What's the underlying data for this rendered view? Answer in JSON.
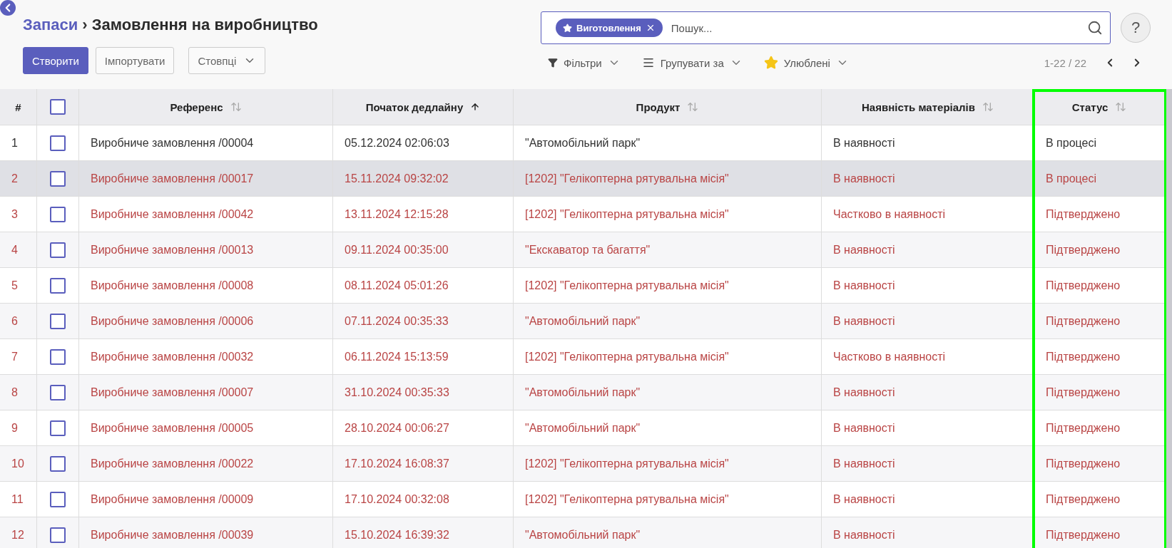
{
  "breadcrumb": {
    "parent": "Запаси",
    "separator": "›",
    "current": "Замовлення на виробництво"
  },
  "actions": [
    {
      "label": "Створити",
      "kind": "primary"
    },
    {
      "label": "Імпортувати",
      "kind": "secondary"
    },
    {
      "label": "Стовпці",
      "kind": "dropdown"
    }
  ],
  "search": {
    "facet": "Виготовлення",
    "placeholder": "Пошук..."
  },
  "help": "?",
  "filters": [
    {
      "label": "Фільтри",
      "kind": "filter"
    },
    {
      "label": "Групувати за",
      "kind": "group"
    },
    {
      "label": "Улюблені",
      "kind": "favorite"
    }
  ],
  "pager": "1-22 / 22",
  "table": {
    "number_header": "#",
    "select_all": {
      "checked": false
    },
    "columns": [
      {
        "label": "Референс",
        "sorted": false,
        "highlighted": false
      },
      {
        "label": "Початок дедлайну",
        "sorted": true,
        "highlighted": false
      },
      {
        "label": "Продукт",
        "sorted": false,
        "highlighted": false
      },
      {
        "label": "Наявність матеріалів",
        "sorted": false,
        "highlighted": false
      },
      {
        "label": "Статус",
        "sorted": false,
        "highlighted": true
      }
    ],
    "rows": [
      {
        "num": "1",
        "checked": false,
        "selected": false,
        "late": false,
        "cells": [
          "Виробниче замовлення /00004",
          "05.12.2024 02:06:03",
          "\"Автомобільний парк\"",
          "В наявності",
          "В процесі"
        ]
      },
      {
        "num": "2",
        "checked": false,
        "selected": true,
        "late": true,
        "cells": [
          "Виробниче замовлення /00017",
          "15.11.2024 09:32:02",
          "[1202] \"Гелікоптерна рятувальна місія\"",
          "В наявності",
          "В процесі"
        ]
      },
      {
        "num": "3",
        "checked": false,
        "selected": false,
        "late": true,
        "cells": [
          "Виробниче замовлення /00042",
          "13.11.2024 12:15:28",
          "[1202] \"Гелікоптерна рятувальна місія\"",
          "Частково в наявності",
          "Підтверджено"
        ]
      },
      {
        "num": "4",
        "checked": false,
        "selected": false,
        "late": true,
        "cells": [
          "Виробниче замовлення /00013",
          "09.11.2024 00:35:00",
          "\"Екскаватор та багаття\"",
          "В наявності",
          "Підтверджено"
        ]
      },
      {
        "num": "5",
        "checked": false,
        "selected": false,
        "late": true,
        "cells": [
          "Виробниче замовлення /00008",
          "08.11.2024 05:01:26",
          "[1202] \"Гелікоптерна рятувальна місія\"",
          "В наявності",
          "Підтверджено"
        ]
      },
      {
        "num": "6",
        "checked": false,
        "selected": false,
        "late": true,
        "cells": [
          "Виробниче замовлення /00006",
          "07.11.2024 00:35:33",
          "\"Автомобільний парк\"",
          "В наявності",
          "Підтверджено"
        ]
      },
      {
        "num": "7",
        "checked": false,
        "selected": false,
        "late": true,
        "cells": [
          "Виробниче замовлення /00032",
          "06.11.2024 15:13:59",
          "[1202] \"Гелікоптерна рятувальна місія\"",
          "Частково в наявності",
          "Підтверджено"
        ]
      },
      {
        "num": "8",
        "checked": false,
        "selected": false,
        "late": true,
        "cells": [
          "Виробниче замовлення /00007",
          "31.10.2024 00:35:33",
          "\"Автомобільний парк\"",
          "В наявності",
          "Підтверджено"
        ]
      },
      {
        "num": "9",
        "checked": false,
        "selected": false,
        "late": true,
        "cells": [
          "Виробниче замовлення /00005",
          "28.10.2024 00:06:27",
          "\"Автомобільний парк\"",
          "В наявності",
          "Підтверджено"
        ]
      },
      {
        "num": "10",
        "checked": false,
        "selected": false,
        "late": true,
        "cells": [
          "Виробниче замовлення /00022",
          "17.10.2024 16:08:37",
          "[1202] \"Гелікоптерна рятувальна місія\"",
          "В наявності",
          "Підтверджено"
        ]
      },
      {
        "num": "11",
        "checked": false,
        "selected": false,
        "late": true,
        "cells": [
          "Виробниче замовлення /00009",
          "17.10.2024 00:32:08",
          "[1202] \"Гелікоптерна рятувальна місія\"",
          "В наявності",
          "Підтверджено"
        ]
      },
      {
        "num": "12",
        "checked": false,
        "selected": false,
        "late": true,
        "cells": [
          "Виробниче замовлення /00039",
          "15.10.2024 16:39:32",
          "\"Автомобільний парк\"",
          "В наявності",
          "Підтверджено"
        ]
      }
    ]
  }
}
